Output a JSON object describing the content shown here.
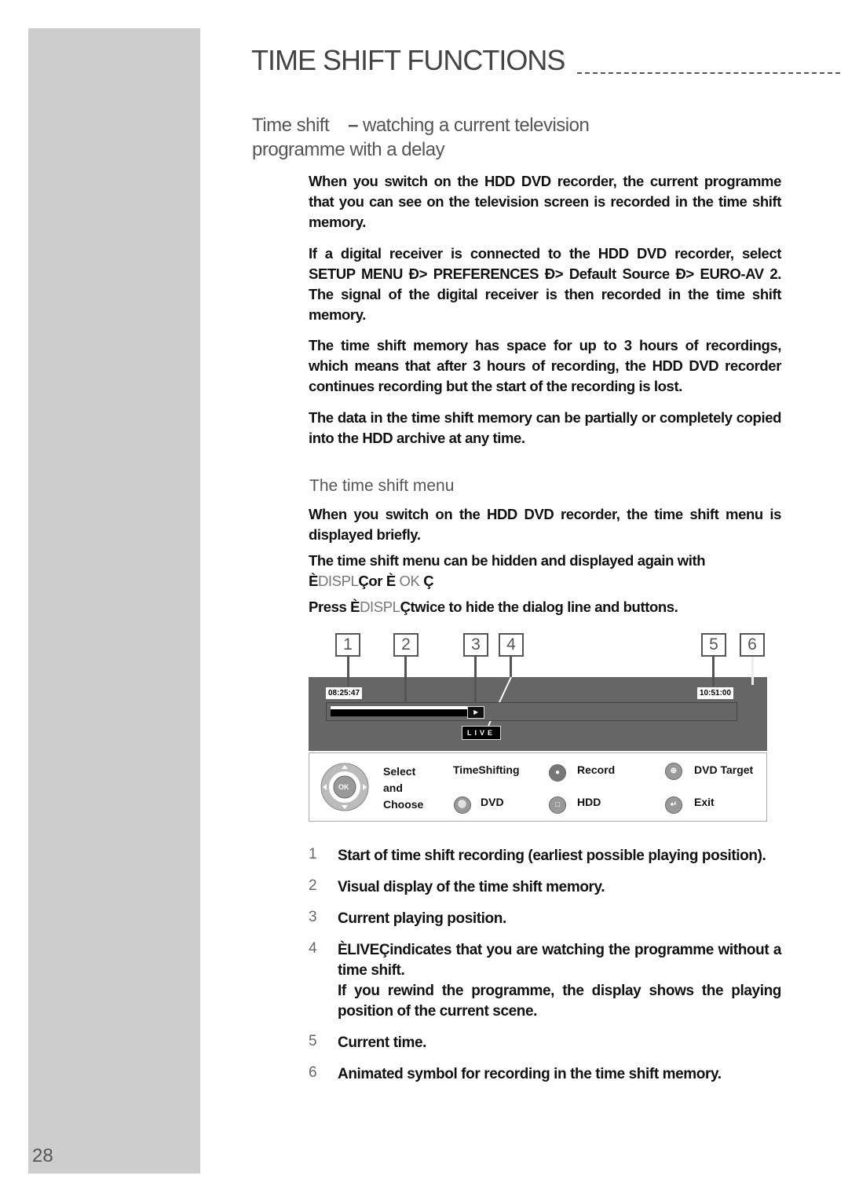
{
  "page": {
    "title": "TIME SHIFT FUNCTIONS",
    "page_number": "28",
    "subtitle": {
      "part1": "Time shift",
      "dash": "–",
      "part2": "watching a current television",
      "line2": "programme with a delay"
    },
    "paragraphs": [
      "When you switch on the HDD DVD recorder, the current programme that you can see on the television screen is recorded in the time shift memory.",
      "If a digital receiver is connected to the HDD DVD recorder, select SETUP MENU Ð> PREFERENCES Ð> Default Source Ð> EURO-AV 2. The signal of the digital receiver is then recorded in the time shift memory.",
      "The time shift memory has space for up to 3 hours of recordings, which means that after 3 hours of recording, the HDD DVD recorder continues recording but the start of the recording is lost.",
      "The data in the time shift memory can be partially or completely copied into the HDD archive at any time."
    ],
    "section": {
      "heading": "The time shift menu",
      "p1": "When you switch on the HDD DVD recorder, the time shift menu is displayed briefly.",
      "p2_text": "The time shift menu can be hidden and displayed again with",
      "p2_open1": "È",
      "p2_key1": "DISPL",
      "p2_close1": "Ç",
      "p2_or": "or È",
      "p2_key2": "OK",
      "p2_close2": "Ç",
      "p3_press": "Press È",
      "p3_key": "DISPL",
      "p3_rest": "Çtwice to hide the dialog line and buttons."
    }
  },
  "figure": {
    "callouts": [
      "1",
      "2",
      "3",
      "4",
      "5",
      "6"
    ],
    "start_time": "08:25:47",
    "current_time": "10:51:00",
    "live_label": "LIVE",
    "progress_fraction": 0.34,
    "legend": {
      "dpad_center": "OK",
      "select_line1": "Select",
      "select_line2": "and",
      "select_line3": "Choose",
      "timeshifting": "TimeShifting",
      "record": "Record",
      "dvd_target": "DVD Target",
      "dvd": "DVD",
      "hdd": "HDD",
      "exit": "Exit"
    }
  },
  "items": [
    {
      "num": "1",
      "text": "Start of time shift recording (earliest possible playing position)."
    },
    {
      "num": "2",
      "text": "Visual display of the time shift memory."
    },
    {
      "num": "3",
      "text": "Current playing position."
    },
    {
      "num": "4",
      "text": "ÈLIVEÇindicates that you are watching the programme without a time shift.",
      "text2": "If you rewind the programme, the display shows the playing position of the current scene."
    },
    {
      "num": "5",
      "text": "Current time."
    },
    {
      "num": "6",
      "text": "Animated symbol for recording in the time shift memory."
    }
  ]
}
